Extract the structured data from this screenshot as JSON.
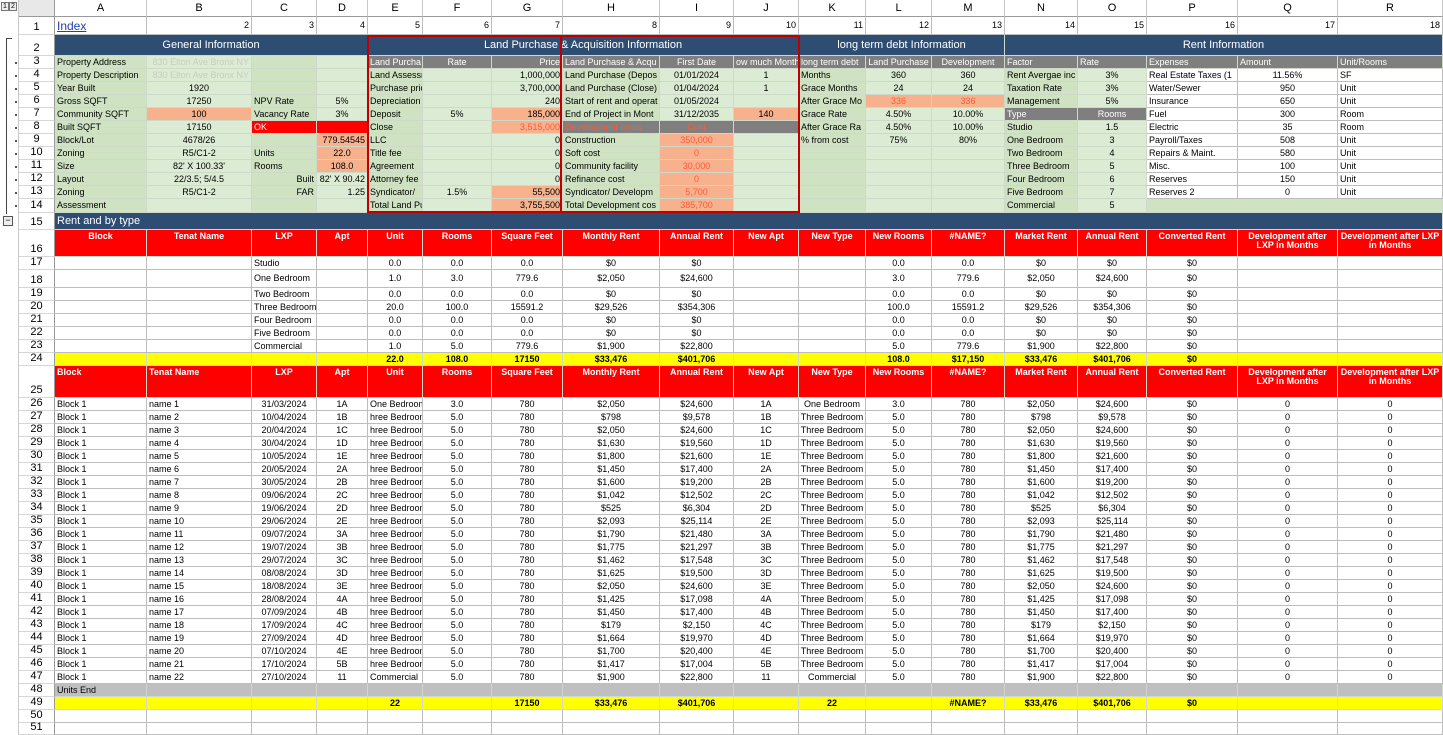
{
  "outline": {
    "btn1": "1",
    "btn2": "2",
    "collapse": "−"
  },
  "columns": [
    "A",
    "B",
    "C",
    "D",
    "E",
    "F",
    "G",
    "H",
    "I",
    "J",
    "K",
    "L",
    "M",
    "N",
    "O",
    "P",
    "Q",
    "R"
  ],
  "rows": [
    "1",
    "2",
    "3",
    "4",
    "5",
    "6",
    "7",
    "8",
    "9",
    "10",
    "11",
    "12",
    "13",
    "14",
    "15",
    "16",
    "17",
    "18",
    "19",
    "20",
    "21",
    "22",
    "23",
    "24",
    "25",
    "26",
    "27",
    "28",
    "29",
    "30",
    "31",
    "32",
    "33",
    "34",
    "35",
    "36",
    "37",
    "38",
    "39",
    "40",
    "41",
    "42",
    "43",
    "44",
    "45",
    "46",
    "47",
    "48",
    "49",
    "50",
    "51"
  ],
  "row1": {
    "index_link": "Index",
    "nums": [
      "2",
      "3",
      "4",
      "5",
      "6",
      "7",
      "8",
      "9",
      "10",
      "11",
      "12",
      "13",
      "14",
      "15",
      "16",
      "17",
      "18"
    ]
  },
  "sections": {
    "general": "General Information",
    "land": "Land Purchase & Acquisition Information",
    "debt": "long term debt Information",
    "rent": "Rent Information"
  },
  "general": {
    "labels": [
      "Property Address",
      "Property Description",
      "Year Built",
      "Gross SQFT",
      "Community SQFT",
      "Built SQFT",
      "Block/Lot",
      "Zoning",
      "Size",
      "Layout",
      "Zoning",
      "Assessment"
    ],
    "values": [
      "830 Elton Ave Bronx NY",
      "830 Elton Ave Bronx NY",
      "1920",
      "17250",
      "100",
      "17150",
      "4678/26",
      "R5/C1-2",
      "82' X 100.33'",
      "22/3.5; 5/4.5",
      "R5/C1-2",
      ""
    ],
    "c_labels": {
      "npv": "NPV Rate",
      "vacancy": "Vacancy Rate",
      "ok": "OK",
      "units": "Units",
      "rooms": "Rooms",
      "built": "Built",
      "far": "FAR"
    },
    "d_values": {
      "npv": "5%",
      "vacancy": "3%",
      "r9": "779.54545",
      "units": "22.0",
      "rooms": "108.0",
      "built": "82' X 90.42",
      "far": "1.25"
    }
  },
  "land": {
    "hdr": {
      "e": "Land Purcha",
      "f": "Rate",
      "g": "Price"
    },
    "labels": [
      "Land Assessment",
      "Purchase price",
      "Depreciation in Months",
      "Deposit",
      "Close",
      "LLC",
      "Title fee",
      "Agreement",
      "Attorney fee",
      "Syndicator/",
      "Total Land Purchase & Acquis"
    ],
    "rates": [
      "",
      "",
      "",
      "5%",
      "",
      "",
      "",
      "",
      "",
      "1.5%",
      ""
    ],
    "prices": [
      "1,000,000",
      "3,700,000",
      "240",
      "185,000",
      "3,515,000",
      "0",
      "0",
      "0",
      "0",
      "55,500",
      "3,755,500"
    ]
  },
  "dates": {
    "hdr": {
      "h": "Land Purchase & Acqu",
      "i": "First Date",
      "j": "ow much Month"
    },
    "labels": [
      "Land Purchase (Depos",
      "Land Purchase (Close)",
      "Start of rent and operat",
      "End of Project in Mont"
    ],
    "dates": [
      "01/01/2024",
      "01/04/2024",
      "01/05/2024",
      "31/12/2035"
    ],
    "months": [
      "1",
      "1",
      "",
      "140"
    ]
  },
  "dev": {
    "hdr": {
      "h": "Development costs",
      "i": "Cost"
    },
    "labels": [
      "Construction",
      "Soft cost",
      "Community facility",
      "Refinance cost",
      "Syndicator/ Developm",
      "Total Development cos"
    ],
    "costs": [
      "350,000",
      "0",
      "30,000",
      "0",
      "5,700",
      "385,700"
    ]
  },
  "debt": {
    "hdr": {
      "k": "long term debt",
      "l": "Land Purchase",
      "m": "Development"
    },
    "labels": [
      "Months",
      "Grace Months",
      "After Grace Mo",
      "Grace Rate",
      "After Grace Ra",
      "% from cost"
    ],
    "land": [
      "360",
      "24",
      "336",
      "4.50%",
      "4.50%",
      "75%"
    ],
    "development": [
      "360",
      "24",
      "336",
      "10.00%",
      "10.00%",
      "80%"
    ]
  },
  "rent_info": {
    "hdr": {
      "n": "Factor",
      "o": "Rate"
    },
    "factors": [
      "Rent Avergae inc",
      "Taxation Rate",
      "Management"
    ],
    "rates": [
      "3%",
      "3%",
      "5%"
    ],
    "type_hdr": {
      "n": "Type",
      "o": "Rooms"
    },
    "types": [
      "Studio",
      "One Bedroom",
      "Two Bedroom",
      "Three Bedroom",
      "Four Bedroom",
      "Five Bedroom",
      "Commercial"
    ],
    "rooms": [
      "1.5",
      "3",
      "4",
      "5",
      "6",
      "7",
      "5"
    ]
  },
  "expenses": {
    "hdr": {
      "p": "Expenses",
      "q": "Amount",
      "r": "Unit/Rooms"
    },
    "names": [
      "Real Estate Taxes (1",
      "Water/Sewer",
      "Insurance",
      "Fuel",
      "Electric",
      "Payroll/Taxes",
      "Repairs & Maint.",
      "Misc.",
      "Reserves",
      "Reserves 2"
    ],
    "amounts": [
      "11.56%",
      "950",
      "650",
      "300",
      "35",
      "508",
      "580",
      "100",
      "150",
      "0"
    ],
    "units": [
      "SF",
      "Unit",
      "Unit",
      "Room",
      "Room",
      "Unit",
      "Unit",
      "Unit",
      "Unit",
      "Unit"
    ]
  },
  "rent_section": {
    "title": "Rent and by type"
  },
  "summary": {
    "headers": [
      "Block",
      "Tenat Name",
      "LXP",
      "Apt",
      "Unit",
      "Rooms",
      "Square Feet",
      "Monthly Rent",
      "Annual Rent",
      "New Apt",
      "New Type",
      "New Rooms",
      "#NAME?",
      "Market Rent",
      "Annual Rent",
      "Converted Rent",
      "Development after LXP in Months",
      "Development after LXP in Months"
    ],
    "types": [
      "Studio",
      "One Bedroom",
      "Two Bedroom",
      "Three Bedroom",
      "Four Bedroom",
      "Five Bedroom",
      "Commercial"
    ],
    "unit": [
      "0.0",
      "1.0",
      "0.0",
      "20.0",
      "0.0",
      "0.0",
      "1.0"
    ],
    "rooms": [
      "0.0",
      "3.0",
      "0.0",
      "100.0",
      "0.0",
      "0.0",
      "5.0"
    ],
    "sqft": [
      "0.0",
      "779.6",
      "0.0",
      "15591.2",
      "0.0",
      "0.0",
      "779.6"
    ],
    "monthly": [
      "$0",
      "$2,050",
      "$0",
      "$29,526",
      "$0",
      "$0",
      "$1,900"
    ],
    "annual": [
      "$0",
      "$24,600",
      "$0",
      "$354,306",
      "$0",
      "$0",
      "$22,800"
    ],
    "new_rooms": [
      "0.0",
      "3.0",
      "0.0",
      "100.0",
      "0.0",
      "0.0",
      "5.0"
    ],
    "name_col": [
      "0.0",
      "779.6",
      "0.0",
      "15591.2",
      "0.0",
      "0.0",
      "779.6"
    ],
    "market": [
      "$0",
      "$2,050",
      "$0",
      "$29,526",
      "$0",
      "$0",
      "$1,900"
    ],
    "annual2": [
      "$0",
      "$24,600",
      "$0",
      "$354,306",
      "$0",
      "$0",
      "$22,800"
    ],
    "converted": [
      "$0",
      "$0",
      "$0",
      "$0",
      "$0",
      "$0",
      "$0"
    ],
    "totals": {
      "unit": "22.0",
      "rooms": "108.0",
      "sqft": "17150",
      "monthly": "$33,476",
      "annual": "$401,706",
      "new_rooms": "108.0",
      "name_col": "$17,150",
      "market": "$33,476",
      "annual2": "$401,706",
      "converted": "$0"
    }
  },
  "units": {
    "headers": [
      "Block",
      "Tenat Name",
      "LXP",
      "Apt",
      "Unit",
      "Rooms",
      "Square Feet",
      "Monthly Rent",
      "Annual Rent",
      "New Apt",
      "New Type",
      "New Rooms",
      "#NAME?",
      "Market Rent",
      "Annual Rent",
      "Converted Rent",
      "Development after LXP in Months",
      "Development after LXP in Months"
    ],
    "rows": [
      [
        "Block 1",
        "name 1",
        "31/03/2024",
        "1A",
        "One Bedroom",
        "3.0",
        "780",
        "$2,050",
        "$24,600",
        "1A",
        "One Bedroom",
        "3.0",
        "780",
        "$2,050",
        "$24,600",
        "$0",
        "0",
        "0"
      ],
      [
        "Block 1",
        "name 2",
        "10/04/2024",
        "1B",
        "hree Bedroom",
        "5.0",
        "780",
        "$798",
        "$9,578",
        "1B",
        "Three Bedroom",
        "5.0",
        "780",
        "$798",
        "$9,578",
        "$0",
        "0",
        "0"
      ],
      [
        "Block 1",
        "name 3",
        "20/04/2024",
        "1C",
        "hree Bedroom",
        "5.0",
        "780",
        "$2,050",
        "$24,600",
        "1C",
        "Three Bedroom",
        "5.0",
        "780",
        "$2,050",
        "$24,600",
        "$0",
        "0",
        "0"
      ],
      [
        "Block 1",
        "name 4",
        "30/04/2024",
        "1D",
        "hree Bedroom",
        "5.0",
        "780",
        "$1,630",
        "$19,560",
        "1D",
        "Three Bedroom",
        "5.0",
        "780",
        "$1,630",
        "$19,560",
        "$0",
        "0",
        "0"
      ],
      [
        "Block 1",
        "name 5",
        "10/05/2024",
        "1E",
        "hree Bedroom",
        "5.0",
        "780",
        "$1,800",
        "$21,600",
        "1E",
        "Three Bedroom",
        "5.0",
        "780",
        "$1,800",
        "$21,600",
        "$0",
        "0",
        "0"
      ],
      [
        "Block 1",
        "name 6",
        "20/05/2024",
        "2A",
        "hree Bedroom",
        "5.0",
        "780",
        "$1,450",
        "$17,400",
        "2A",
        "Three Bedroom",
        "5.0",
        "780",
        "$1,450",
        "$17,400",
        "$0",
        "0",
        "0"
      ],
      [
        "Block 1",
        "name 7",
        "30/05/2024",
        "2B",
        "hree Bedroom",
        "5.0",
        "780",
        "$1,600",
        "$19,200",
        "2B",
        "Three Bedroom",
        "5.0",
        "780",
        "$1,600",
        "$19,200",
        "$0",
        "0",
        "0"
      ],
      [
        "Block 1",
        "name 8",
        "09/06/2024",
        "2C",
        "hree Bedroom",
        "5.0",
        "780",
        "$1,042",
        "$12,502",
        "2C",
        "Three Bedroom",
        "5.0",
        "780",
        "$1,042",
        "$12,502",
        "$0",
        "0",
        "0"
      ],
      [
        "Block 1",
        "name 9",
        "19/06/2024",
        "2D",
        "hree Bedroom",
        "5.0",
        "780",
        "$525",
        "$6,304",
        "2D",
        "Three Bedroom",
        "5.0",
        "780",
        "$525",
        "$6,304",
        "$0",
        "0",
        "0"
      ],
      [
        "Block 1",
        "name 10",
        "29/06/2024",
        "2E",
        "hree Bedroom",
        "5.0",
        "780",
        "$2,093",
        "$25,114",
        "2E",
        "Three Bedroom",
        "5.0",
        "780",
        "$2,093",
        "$25,114",
        "$0",
        "0",
        "0"
      ],
      [
        "Block 1",
        "name 11",
        "09/07/2024",
        "3A",
        "hree Bedroom",
        "5.0",
        "780",
        "$1,790",
        "$21,480",
        "3A",
        "Three Bedroom",
        "5.0",
        "780",
        "$1,790",
        "$21,480",
        "$0",
        "0",
        "0"
      ],
      [
        "Block 1",
        "name 12",
        "19/07/2024",
        "3B",
        "hree Bedroom",
        "5.0",
        "780",
        "$1,775",
        "$21,297",
        "3B",
        "Three Bedroom",
        "5.0",
        "780",
        "$1,775",
        "$21,297",
        "$0",
        "0",
        "0"
      ],
      [
        "Block 1",
        "name 13",
        "29/07/2024",
        "3C",
        "hree Bedroom",
        "5.0",
        "780",
        "$1,462",
        "$17,548",
        "3C",
        "Three Bedroom",
        "5.0",
        "780",
        "$1,462",
        "$17,548",
        "$0",
        "0",
        "0"
      ],
      [
        "Block 1",
        "name 14",
        "08/08/2024",
        "3D",
        "hree Bedroom",
        "5.0",
        "780",
        "$1,625",
        "$19,500",
        "3D",
        "Three Bedroom",
        "5.0",
        "780",
        "$1,625",
        "$19,500",
        "$0",
        "0",
        "0"
      ],
      [
        "Block 1",
        "name 15",
        "18/08/2024",
        "3E",
        "hree Bedroom",
        "5.0",
        "780",
        "$2,050",
        "$24,600",
        "3E",
        "Three Bedroom",
        "5.0",
        "780",
        "$2,050",
        "$24,600",
        "$0",
        "0",
        "0"
      ],
      [
        "Block 1",
        "name 16",
        "28/08/2024",
        "4A",
        "hree Bedroom",
        "5.0",
        "780",
        "$1,425",
        "$17,098",
        "4A",
        "Three Bedroom",
        "5.0",
        "780",
        "$1,425",
        "$17,098",
        "$0",
        "0",
        "0"
      ],
      [
        "Block 1",
        "name 17",
        "07/09/2024",
        "4B",
        "hree Bedroom",
        "5.0",
        "780",
        "$1,450",
        "$17,400",
        "4B",
        "Three Bedroom",
        "5.0",
        "780",
        "$1,450",
        "$17,400",
        "$0",
        "0",
        "0"
      ],
      [
        "Block 1",
        "name 18",
        "17/09/2024",
        "4C",
        "hree Bedroom",
        "5.0",
        "780",
        "$179",
        "$2,150",
        "4C",
        "Three Bedroom",
        "5.0",
        "780",
        "$179",
        "$2,150",
        "$0",
        "0",
        "0"
      ],
      [
        "Block 1",
        "name 19",
        "27/09/2024",
        "4D",
        "hree Bedroom",
        "5.0",
        "780",
        "$1,664",
        "$19,970",
        "4D",
        "Three Bedroom",
        "5.0",
        "780",
        "$1,664",
        "$19,970",
        "$0",
        "0",
        "0"
      ],
      [
        "Block 1",
        "name 20",
        "07/10/2024",
        "4E",
        "hree Bedroom",
        "5.0",
        "780",
        "$1,700",
        "$20,400",
        "4E",
        "Three Bedroom",
        "5.0",
        "780",
        "$1,700",
        "$20,400",
        "$0",
        "0",
        "0"
      ],
      [
        "Block 1",
        "name 21",
        "17/10/2024",
        "5B",
        "hree Bedroom",
        "5.0",
        "780",
        "$1,417",
        "$17,004",
        "5B",
        "Three Bedroom",
        "5.0",
        "780",
        "$1,417",
        "$17,004",
        "$0",
        "0",
        "0"
      ],
      [
        "Block 1",
        "name 22",
        "27/10/2024",
        "11",
        "Commercial",
        "5.0",
        "780",
        "$1,900",
        "$22,800",
        "11",
        "Commercial",
        "5.0",
        "780",
        "$1,900",
        "$22,800",
        "$0",
        "0",
        "0"
      ]
    ],
    "end_label": "Units End",
    "totals": {
      "unit": "22",
      "sqft": "17150",
      "monthly": "$33,476",
      "annual": "$401,706",
      "new_apt": "22",
      "name_col": "#NAME?",
      "market": "$33,476",
      "annual2": "$401,706",
      "converted": "$0"
    }
  }
}
